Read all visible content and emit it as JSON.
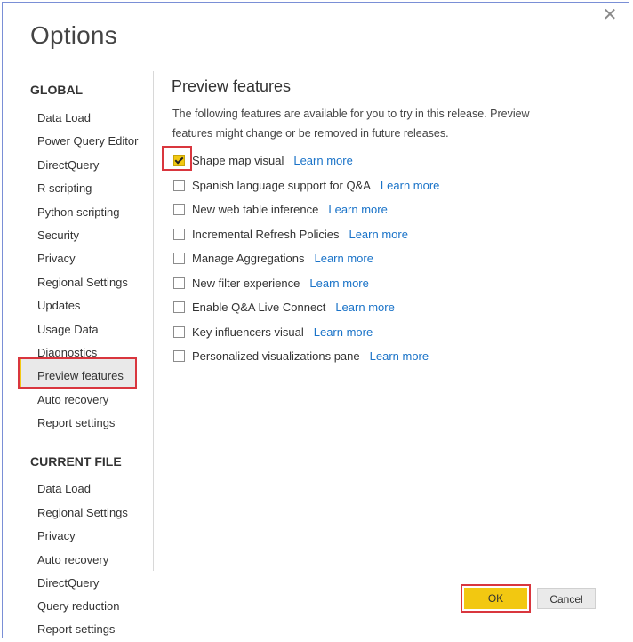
{
  "dialog": {
    "title": "Options",
    "close_icon": "close-icon"
  },
  "sidebar": {
    "global_heading": "GLOBAL",
    "global_items": [
      {
        "label": "Data Load"
      },
      {
        "label": "Power Query Editor"
      },
      {
        "label": "DirectQuery"
      },
      {
        "label": "R scripting"
      },
      {
        "label": "Python scripting"
      },
      {
        "label": "Security"
      },
      {
        "label": "Privacy"
      },
      {
        "label": "Regional Settings"
      },
      {
        "label": "Updates"
      },
      {
        "label": "Usage Data"
      },
      {
        "label": "Diagnostics"
      },
      {
        "label": "Preview features",
        "selected": true
      },
      {
        "label": "Auto recovery"
      },
      {
        "label": "Report settings"
      }
    ],
    "current_file_heading": "CURRENT FILE",
    "current_file_items": [
      {
        "label": "Data Load"
      },
      {
        "label": "Regional Settings"
      },
      {
        "label": "Privacy"
      },
      {
        "label": "Auto recovery"
      },
      {
        "label": "DirectQuery"
      },
      {
        "label": "Query reduction"
      },
      {
        "label": "Report settings"
      }
    ]
  },
  "panel": {
    "title": "Preview features",
    "description": "The following features are available for you to try in this release. Preview features might change or be removed in future releases.",
    "features": [
      {
        "label": "Shape map visual",
        "checked": true,
        "link": "Learn more"
      },
      {
        "label": "Spanish language support for Q&A",
        "checked": false,
        "link": "Learn more"
      },
      {
        "label": "New web table inference",
        "checked": false,
        "link": "Learn more"
      },
      {
        "label": "Incremental Refresh Policies",
        "checked": false,
        "link": "Learn more"
      },
      {
        "label": "Manage Aggregations",
        "checked": false,
        "link": "Learn more"
      },
      {
        "label": "New filter experience",
        "checked": false,
        "link": "Learn more"
      },
      {
        "label": "Enable Q&A Live Connect",
        "checked": false,
        "link": "Learn more"
      },
      {
        "label": "Key influencers visual",
        "checked": false,
        "link": "Learn more"
      },
      {
        "label": "Personalized visualizations pane",
        "checked": false,
        "link": "Learn more"
      }
    ]
  },
  "buttons": {
    "ok_label": "OK",
    "cancel_label": "Cancel"
  },
  "colors": {
    "accent": "#f2c811",
    "link": "#1a73c8",
    "highlight_box": "#d9363e"
  }
}
